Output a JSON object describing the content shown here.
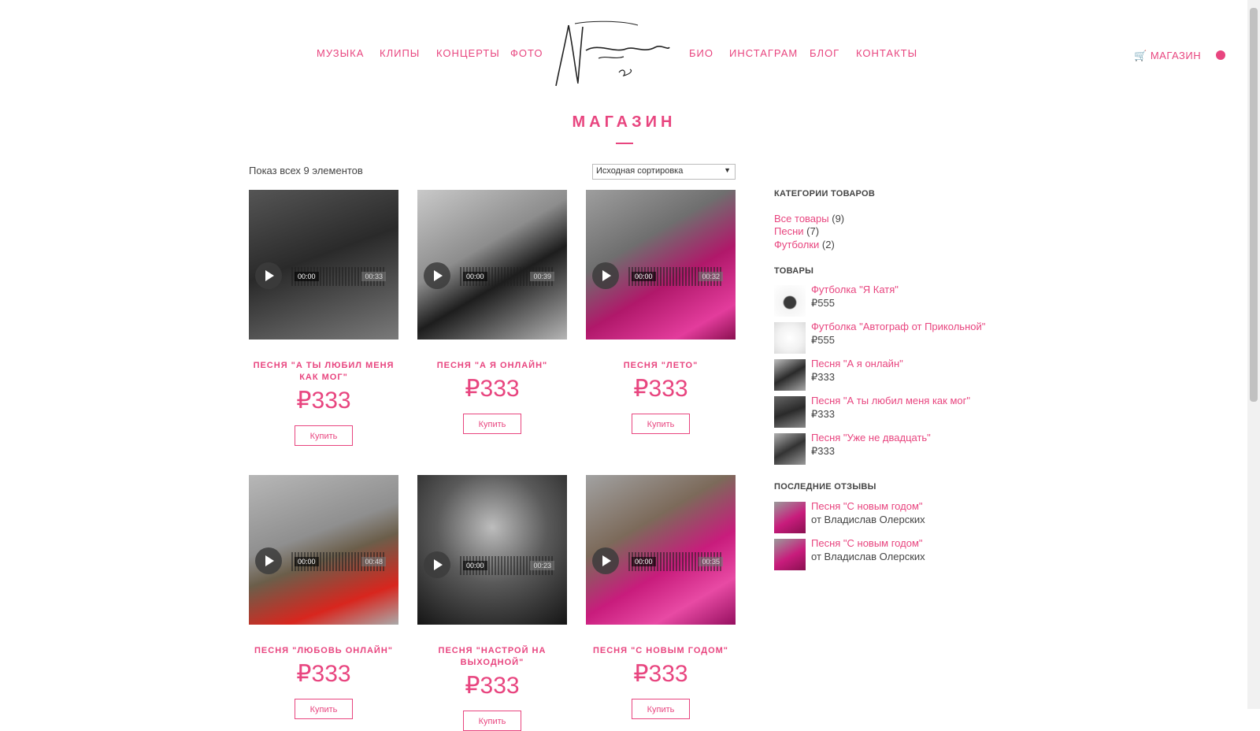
{
  "nav": {
    "left": [
      "МУЗЫКА",
      "КЛИПЫ",
      "КОНЦЕРТЫ",
      "ФОТО"
    ],
    "right": [
      "БИО",
      "ИНСТАГРАМ",
      "БЛОГ",
      "КОНТАКТЫ"
    ],
    "shop": "МАГАЗИН"
  },
  "page_title": "МАГАЗИН",
  "result_count": "Показ всех 9 элементов",
  "sort": {
    "selected": "Исходная сортировка"
  },
  "products": [
    {
      "name": "ПЕСНЯ \"А ТЫ ЛЮБИЛ МЕНЯ КАК МОГ\"",
      "price": "₽333",
      "buy": "Купить",
      "time_start": "00:00",
      "time_end": "00:33"
    },
    {
      "name": "ПЕСНЯ \"А Я ОНЛАЙН\"",
      "price": "₽333",
      "buy": "Купить",
      "time_start": "00:00",
      "time_end": "00:39"
    },
    {
      "name": "ПЕСНЯ \"ЛЕТО\"",
      "price": "₽333",
      "buy": "Купить",
      "time_start": "00:00",
      "time_end": "00:32"
    },
    {
      "name": "ПЕСНЯ \"ЛЮБОВЬ ОНЛАЙН\"",
      "price": "₽333",
      "buy": "Купить",
      "time_start": "00:00",
      "time_end": "00:48"
    },
    {
      "name": "ПЕСНЯ \"НАСТРОЙ НА ВЫХОДНОЙ\"",
      "price": "₽333",
      "buy": "Купить",
      "time_start": "00:00",
      "time_end": "00:23"
    },
    {
      "name": "ПЕСНЯ \"С НОВЫМ ГОДОМ\"",
      "price": "₽333",
      "buy": "Купить",
      "time_start": "00:00",
      "time_end": "00:35"
    }
  ],
  "sidebar": {
    "categories_title": "КАТЕГОРИИ ТОВАРОВ",
    "categories": [
      {
        "label": "Все товары",
        "count": "(9)"
      },
      {
        "label": "Песни",
        "count": "(7)"
      },
      {
        "label": "Футболки",
        "count": "(2)"
      }
    ],
    "products_title": "ТОВАРЫ",
    "products": [
      {
        "title": "Футболка \"Я Катя\"",
        "price": "₽555"
      },
      {
        "title": "Футболка \"Автограф от Прикольной\"",
        "price": "₽555"
      },
      {
        "title": "Песня \"А я онлайн\"",
        "price": "₽333"
      },
      {
        "title": "Песня \"А ты любил меня как мог\"",
        "price": "₽333"
      },
      {
        "title": "Песня \"Уже не двадцать\"",
        "price": "₽333"
      }
    ],
    "reviews_title": "ПОСЛЕДНИЕ ОТЗЫВЫ",
    "reviews": [
      {
        "title": "Песня \"С новым годом\"",
        "author": "от Владислав Олерских"
      },
      {
        "title": "Песня \"С новым годом\"",
        "author": "от Владислав Олерских"
      }
    ]
  },
  "colors": {
    "accent": "#e8457f"
  }
}
